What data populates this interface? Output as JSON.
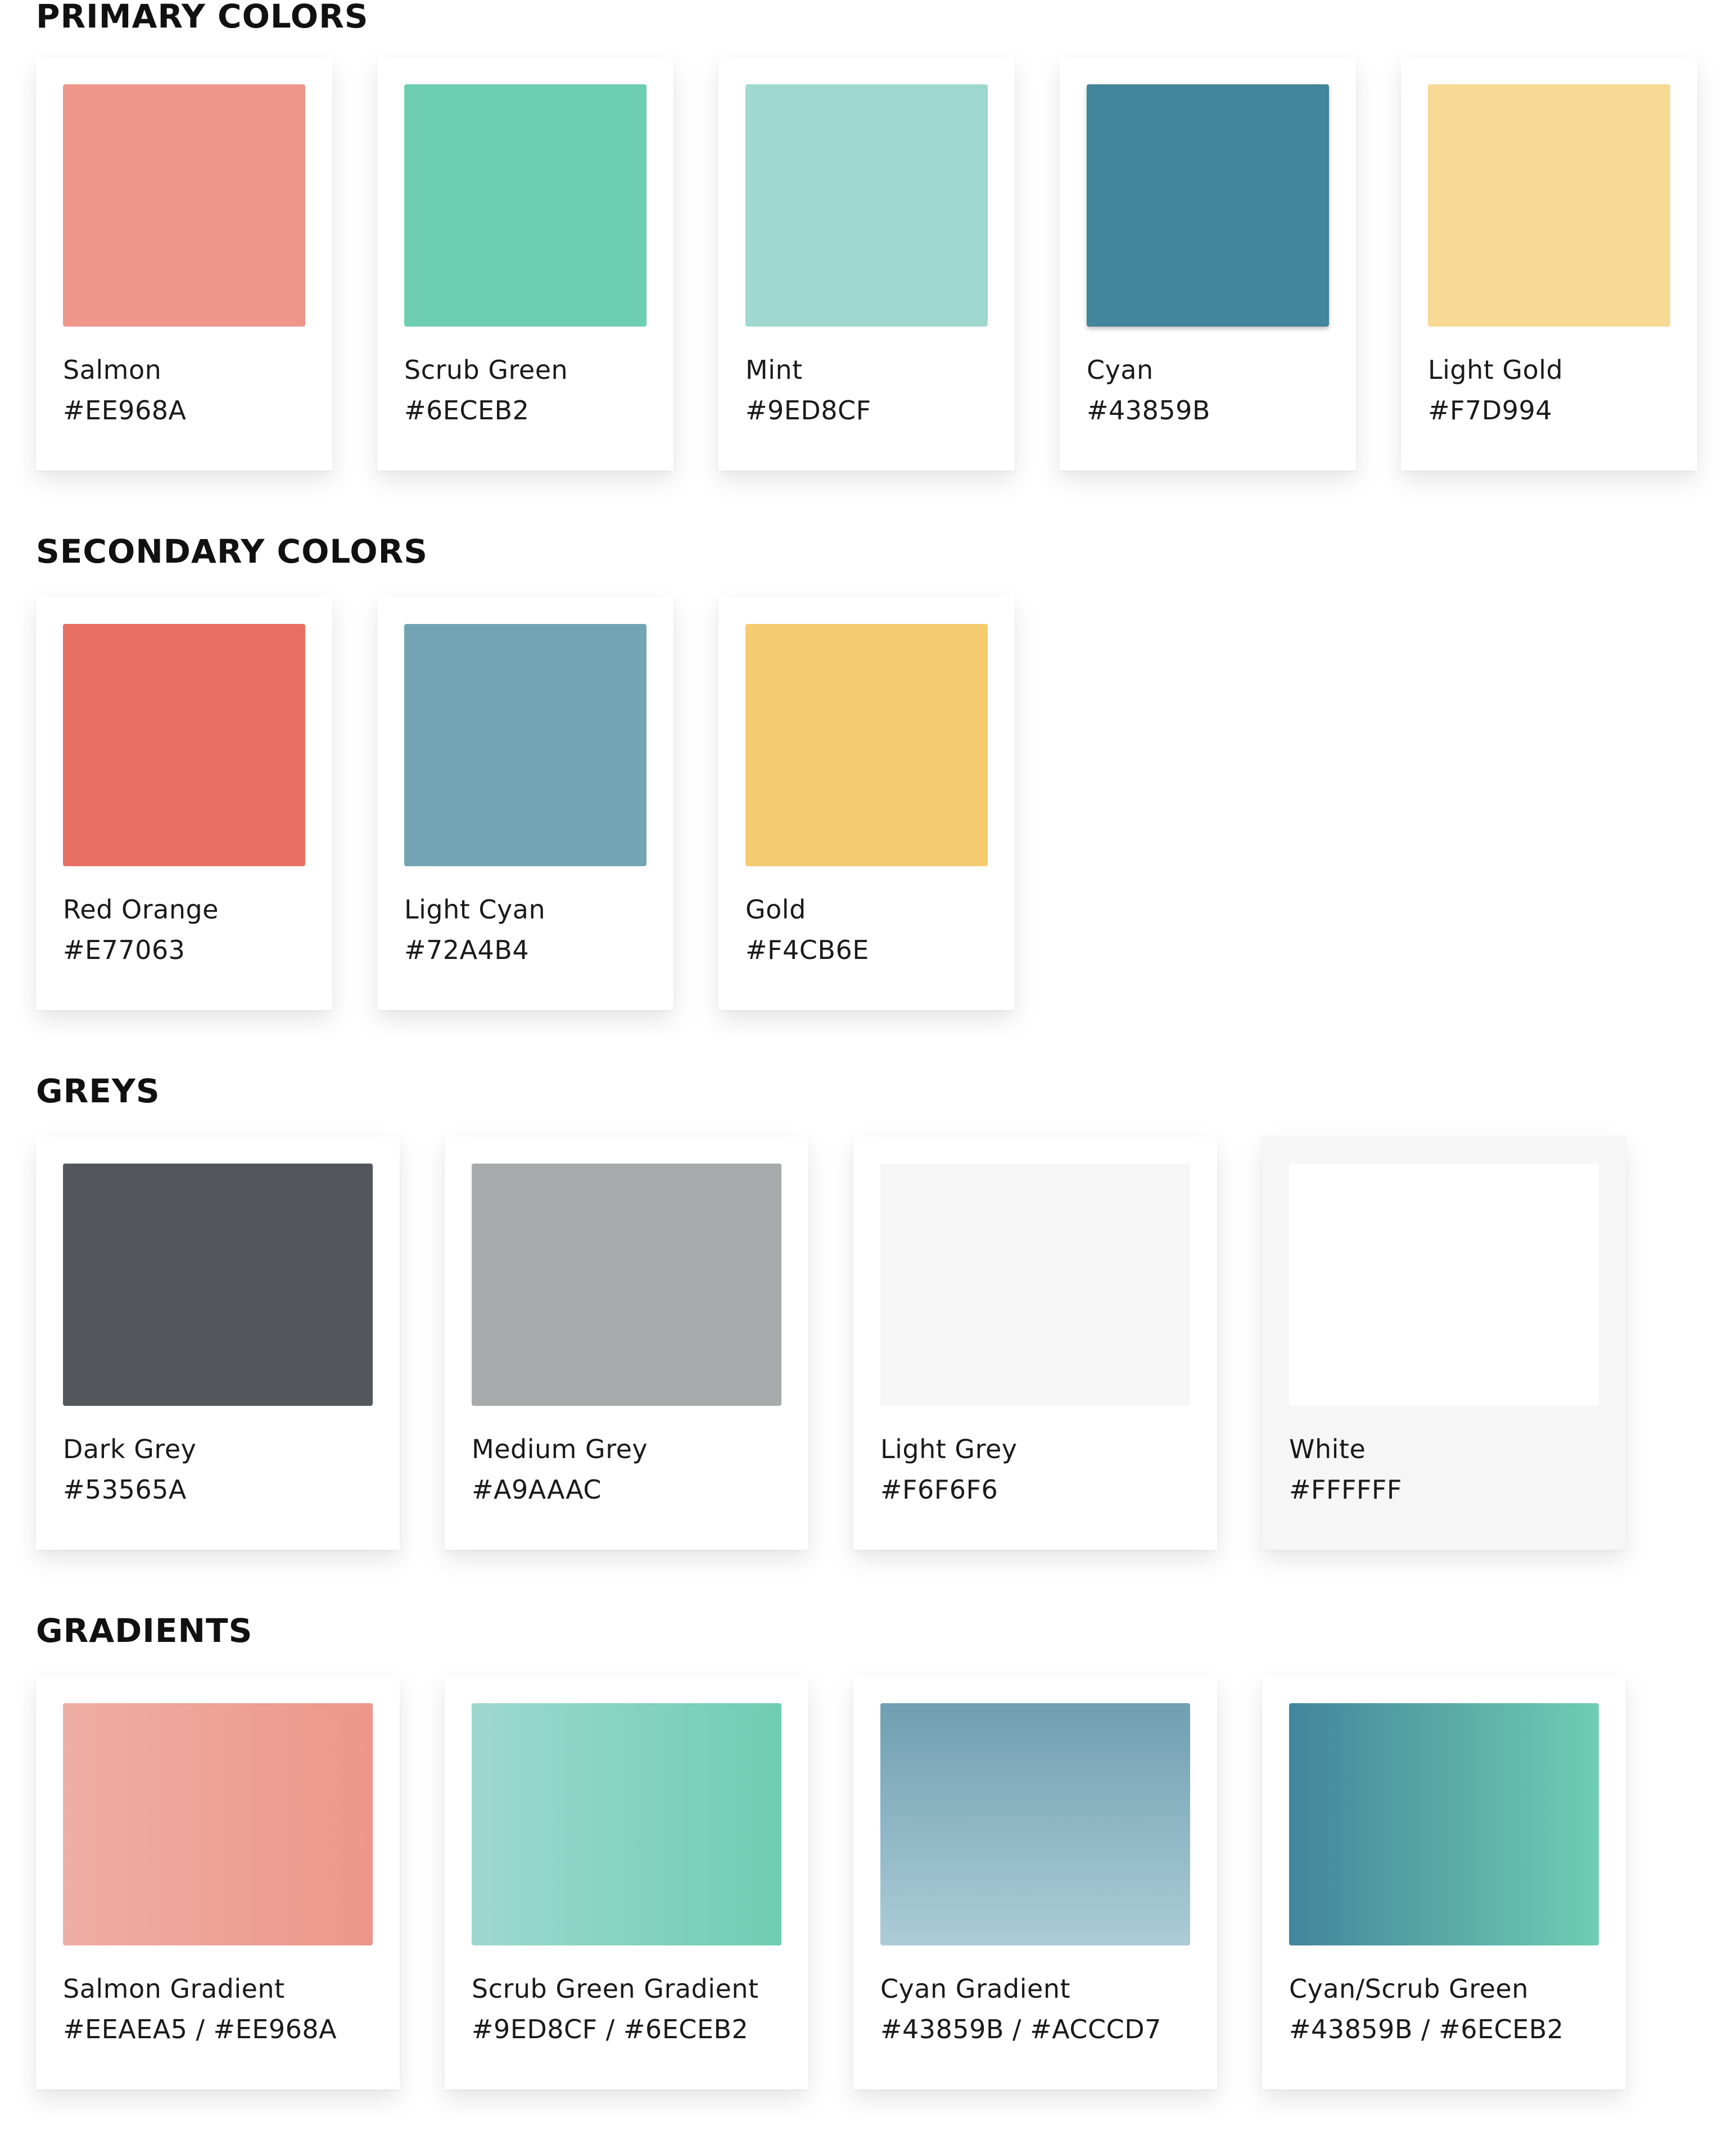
{
  "sections": {
    "primary": {
      "title": "PRIMARY COLORS",
      "swatches": [
        {
          "name": "Salmon",
          "hex": "#EE968A",
          "color": "#EE968A"
        },
        {
          "name": "Scrub Green",
          "hex": "#6ECEB2",
          "color": "#6ECEB2"
        },
        {
          "name": "Mint",
          "hex": "#9ED8CF",
          "color": "#9ED8CF"
        },
        {
          "name": "Cyan",
          "hex": "#43859B",
          "color": "#43859B"
        },
        {
          "name": "Light Gold",
          "hex": "#F7D994",
          "color": "#F7D994"
        }
      ]
    },
    "secondary": {
      "title": "SECONDARY COLORS",
      "swatches": [
        {
          "name": "Red Orange",
          "hex": "#E77063",
          "color": "#E77063"
        },
        {
          "name": "Light Cyan",
          "hex": "#72A4B4",
          "color": "#72A4B4"
        },
        {
          "name": "Gold",
          "hex": "#F4CB6E",
          "color": "#F4CB6E"
        }
      ]
    },
    "greys": {
      "title": "GREYS",
      "swatches": [
        {
          "name": "Dark Grey",
          "hex": "#53565A",
          "color": "#53565A"
        },
        {
          "name": "Medium Grey",
          "hex": "#A9AAAC",
          "color": "#A9AAAC"
        },
        {
          "name": "Light Grey",
          "hex": "#F6F6F6",
          "color": "#F6F6F6"
        },
        {
          "name": "White",
          "hex": "#FFFFFF",
          "color": "#FFFFFF"
        }
      ]
    },
    "gradients": {
      "title": "GRADIENTS",
      "swatches": [
        {
          "name": "Salmon Gradient",
          "hex": "#EEAEA5 / #EE968A",
          "from": "#EEAEA5",
          "to": "#EE968A",
          "direction": "to right"
        },
        {
          "name": "Scrub Green Gradient",
          "hex": "#9ED8CF / #6ECEB2",
          "from": "#9ED8CF",
          "to": "#6ECEB2",
          "direction": "to right"
        },
        {
          "name": "Cyan Gradient",
          "hex": "#43859B / #ACCCD7",
          "from": "#6F9FB1",
          "to": "#ACCCD7",
          "direction": "to bottom"
        },
        {
          "name": "Cyan/Scrub Green",
          "hex": "#43859B / #6ECEB2",
          "from": "#43859B",
          "to": "#6ECEB2",
          "direction": "to right"
        }
      ]
    }
  }
}
